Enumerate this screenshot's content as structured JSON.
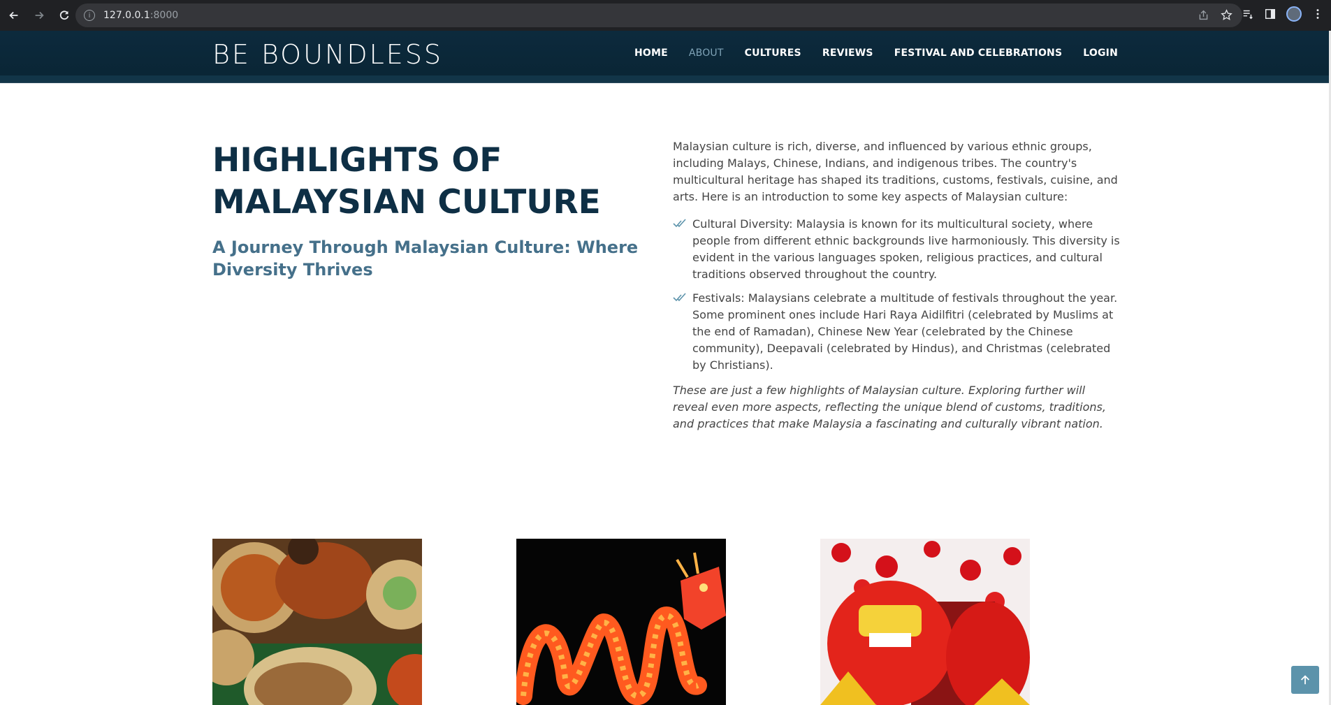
{
  "browser": {
    "url_host": "127.0.0.1",
    "url_port": ":8000"
  },
  "site": {
    "logo": "BE BOUNDLESS",
    "menu": [
      {
        "label": "HOME",
        "active": false
      },
      {
        "label": "ABOUT",
        "active": true
      },
      {
        "label": "CULTURES",
        "active": false
      },
      {
        "label": "REVIEWS",
        "active": false
      },
      {
        "label": "FESTIVAL AND CELEBRATIONS",
        "active": false
      },
      {
        "label": "LOGIN",
        "active": false
      }
    ]
  },
  "main": {
    "heading": "HIGHLIGHTS OF MALAYSIAN CULTURE",
    "subheading": "A Journey Through Malaysian Culture: Where Diversity Thrives",
    "intro": "Malaysian culture is rich, diverse, and influenced by various ethnic groups, including Malays, Chinese, Indians, and indigenous tribes. The country's multicultural heritage has shaped its traditions, customs, festivals, cuisine, and arts. Here is an introduction to some key aspects of Malaysian culture:",
    "bullets": [
      "Cultural Diversity: Malaysia is known for its multicultural society, where people from different ethnic backgrounds live harmoniously. This diversity is evident in the various languages spoken, religious practices, and cultural traditions observed throughout the country.",
      "Festivals: Malaysians celebrate a multitude of festivals throughout the year. Some prominent ones include Hari Raya Aidilfitri (celebrated by Muslims at the end of Ramadan), Chinese New Year (celebrated by the Chinese community), Deepavali (celebrated by Hindus), and Christmas (celebrated by Christians)."
    ],
    "outro": "These are just a few highlights of Malaysian culture. Exploring further will reveal even more aspects, reflecting the unique blend of customs, traditions, and practices that make Malaysia a fascinating and culturally vibrant nation."
  },
  "colors": {
    "header_bg": "#0c2a3d",
    "heading": "#0e2f45",
    "subheading": "#45708a",
    "accent": "#5c93ab"
  }
}
